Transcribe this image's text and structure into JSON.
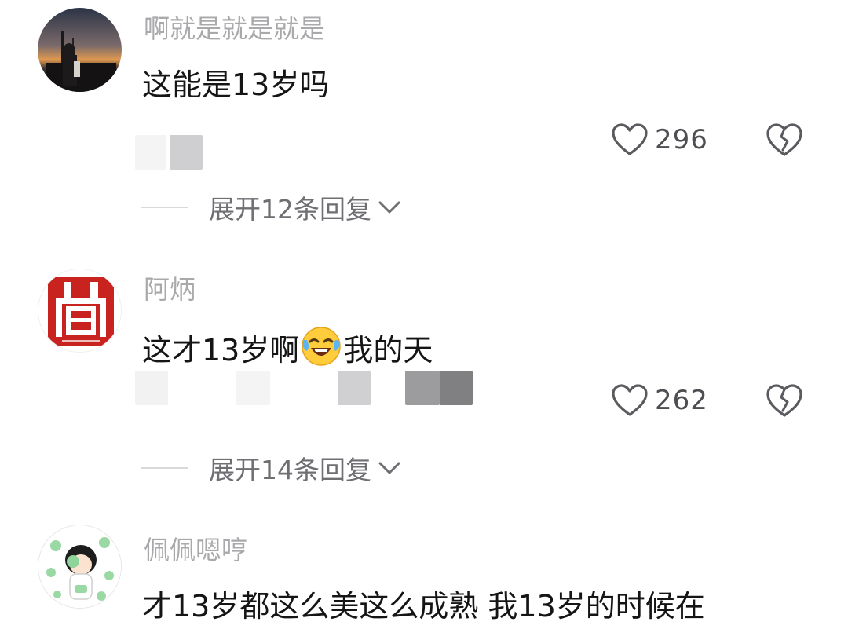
{
  "colors": {
    "background": "#ffffff",
    "username": "#a9a9ac",
    "comment_text": "#151515",
    "count": "#4d4d52",
    "expand_text": "#6e6e73",
    "icon_stroke": "#5a5a5f"
  },
  "comments": [
    {
      "username": "啊就是就是就是",
      "text": "这能是13岁吗",
      "likes": "296",
      "expand_label": "展开12条回复",
      "avatar": "sunset-photo-avatar"
    },
    {
      "username": "阿炳",
      "text_before": "这才13岁啊",
      "emoji": "laughing-crying-emoji",
      "text_after": "我的天",
      "likes": "262",
      "expand_label": "展开14条回复",
      "avatar": "red-seal-avatar"
    },
    {
      "username": "佩佩嗯哼",
      "text": "才13岁都这么美这么成熟 我13岁的时候在",
      "avatar": "cartoon-girl-clover-avatar"
    }
  ],
  "icons": {
    "like": "heart-outline-icon",
    "dislike": "broken-heart-icon",
    "expand": "chevron-down-icon"
  }
}
